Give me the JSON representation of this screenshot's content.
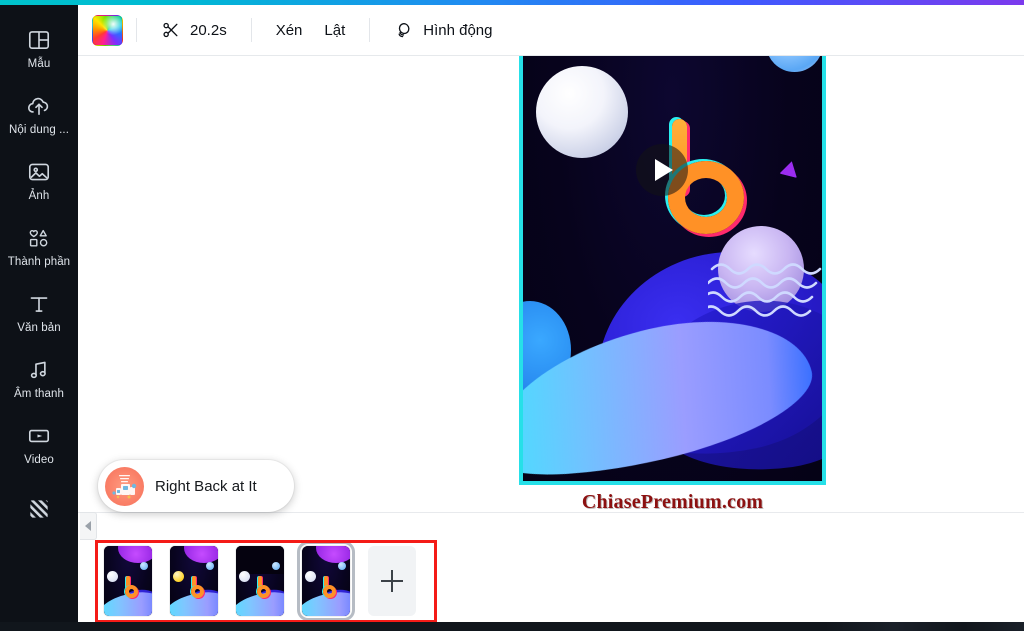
{
  "top_accent": {
    "colors": [
      "#00c4cc",
      "#1f8df0",
      "#7c3aed"
    ]
  },
  "sidebar": {
    "items": [
      {
        "label": "Mẫu",
        "icon": "template-icon"
      },
      {
        "label": "Nội dung ...",
        "icon": "upload-cloud-icon"
      },
      {
        "label": "Ảnh",
        "icon": "photo-icon"
      },
      {
        "label": "Thành phần",
        "icon": "elements-icon"
      },
      {
        "label": "Văn bản",
        "icon": "text-icon"
      },
      {
        "label": "Âm thanh",
        "icon": "audio-note-icon"
      },
      {
        "label": "Video",
        "icon": "video-icon"
      },
      {
        "label": "",
        "icon": "background-pattern-icon"
      }
    ]
  },
  "toolbar": {
    "color_swatch": {
      "name": "rainbow-color-swatch"
    },
    "duration": {
      "label": "20.2s",
      "icon": "scissors-icon"
    },
    "crop_label": "Xén",
    "flip_label": "Lật",
    "animate": {
      "label": "Hình động",
      "icon": "animation-icon"
    }
  },
  "canvas": {
    "selection_color": "#26e0e8",
    "play_button": "play-icon",
    "watermark": "ChiasePremium.com"
  },
  "audio_track": {
    "title": "Right Back at It",
    "thumbnail": "audio-album-thumb"
  },
  "timeline": {
    "collapse_handle": "chevron-left-icon",
    "add_label": "+",
    "clips": [
      {
        "name": "clip-1",
        "selected": false,
        "variant": "white-moon"
      },
      {
        "name": "clip-2",
        "selected": false,
        "variant": "yellow-moon"
      },
      {
        "name": "clip-3",
        "selected": false,
        "variant": "dark-top"
      },
      {
        "name": "clip-4",
        "selected": true,
        "variant": "white-moon"
      }
    ],
    "highlight_color": "#f41b17"
  }
}
